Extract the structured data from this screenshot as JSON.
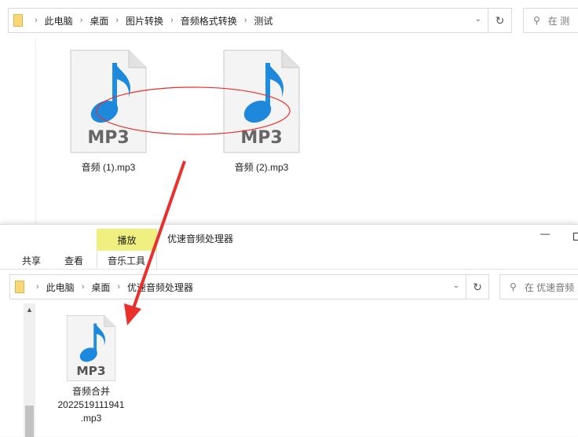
{
  "top_window": {
    "breadcrumb": [
      "此电脑",
      "桌面",
      "图片转换",
      "音频格式转换",
      "测试"
    ],
    "search_placeholder": "在 测",
    "files": [
      {
        "name": "音频 (1).mp3",
        "badge": "MP3"
      },
      {
        "name": "音频 (2).mp3",
        "badge": "MP3"
      }
    ]
  },
  "bottom_window": {
    "title": "优速音频处理器",
    "context_tab": "播放",
    "ribbon_tabs": [
      "共享",
      "查看",
      "音乐工具"
    ],
    "breadcrumb": [
      "此电脑",
      "桌面",
      "优速音频处理器"
    ],
    "search_placeholder": "在 优速音频",
    "files": [
      {
        "name_lines": [
          "音频合并",
          "2022519111941",
          ".mp3"
        ],
        "badge": "MP3"
      }
    ]
  },
  "annotation_color": "#e8302c"
}
